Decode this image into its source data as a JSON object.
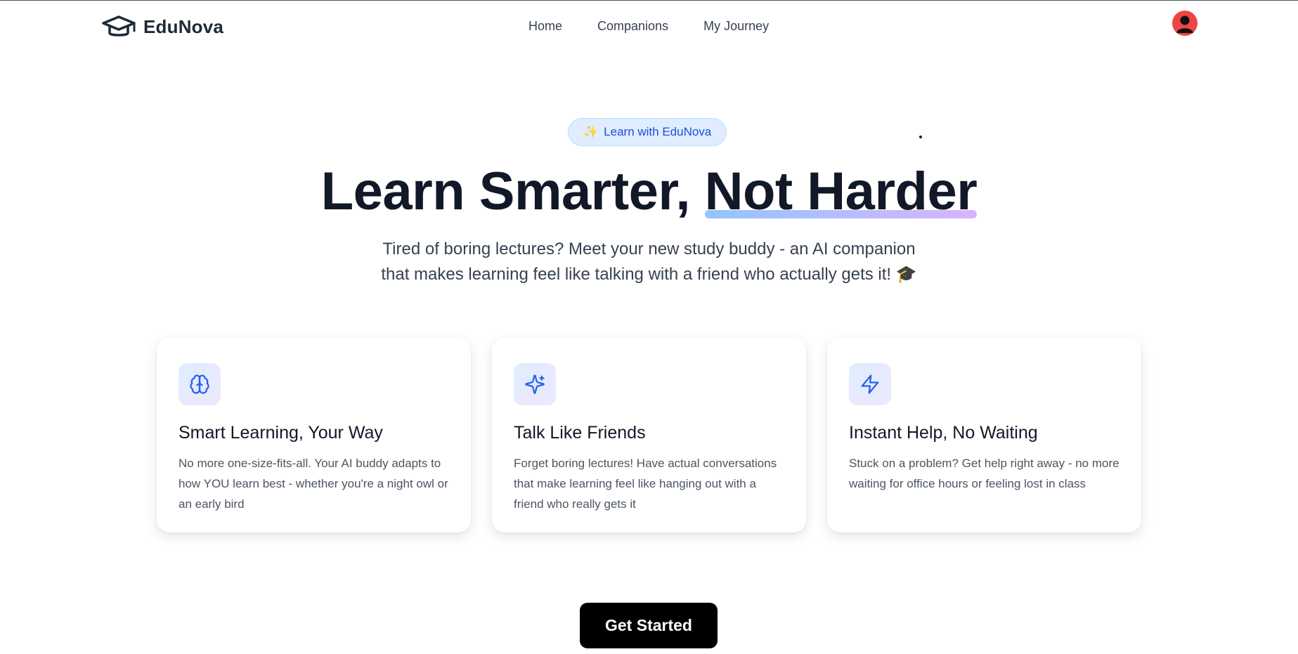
{
  "brand": {
    "name": "EduNova",
    "logo_icon": "graduation-cap-icon"
  },
  "nav": {
    "items": [
      "Home",
      "Companions",
      "My Journey"
    ]
  },
  "user": {
    "avatar_icon": "user-avatar-icon",
    "avatar_color": "#ef4444"
  },
  "hero": {
    "badge_icon": "✨",
    "badge_label": "Learn with EduNova",
    "title_part1": "Learn Smarter, ",
    "title_part2": "Not Harder",
    "subtitle_line1": "Tired of boring lectures? Meet your new study buddy - an AI companion",
    "subtitle_line2": "that makes learning feel like talking with a friend who actually gets it! 🎓"
  },
  "features": [
    {
      "icon": "brain-icon",
      "title": "Smart Learning, Your Way",
      "text": "No more one-size-fits-all. Your AI buddy adapts to how YOU learn best - whether you're a night owl or an early bird"
    },
    {
      "icon": "sparkles-icon",
      "title": "Talk Like Friends",
      "text": "Forget boring lectures! Have actual conversations that make learning feel like hanging out with a friend who really gets it"
    },
    {
      "icon": "lightning-icon",
      "title": "Instant Help, No Waiting",
      "text": "Stuck on a problem? Get help right away - no more waiting for office hours or feeling lost in class"
    }
  ],
  "cta": {
    "label": "Get Started"
  },
  "colors": {
    "accent": "#1d4ed8",
    "icon_stroke": "#2563eb",
    "cta_bg": "#000000"
  }
}
